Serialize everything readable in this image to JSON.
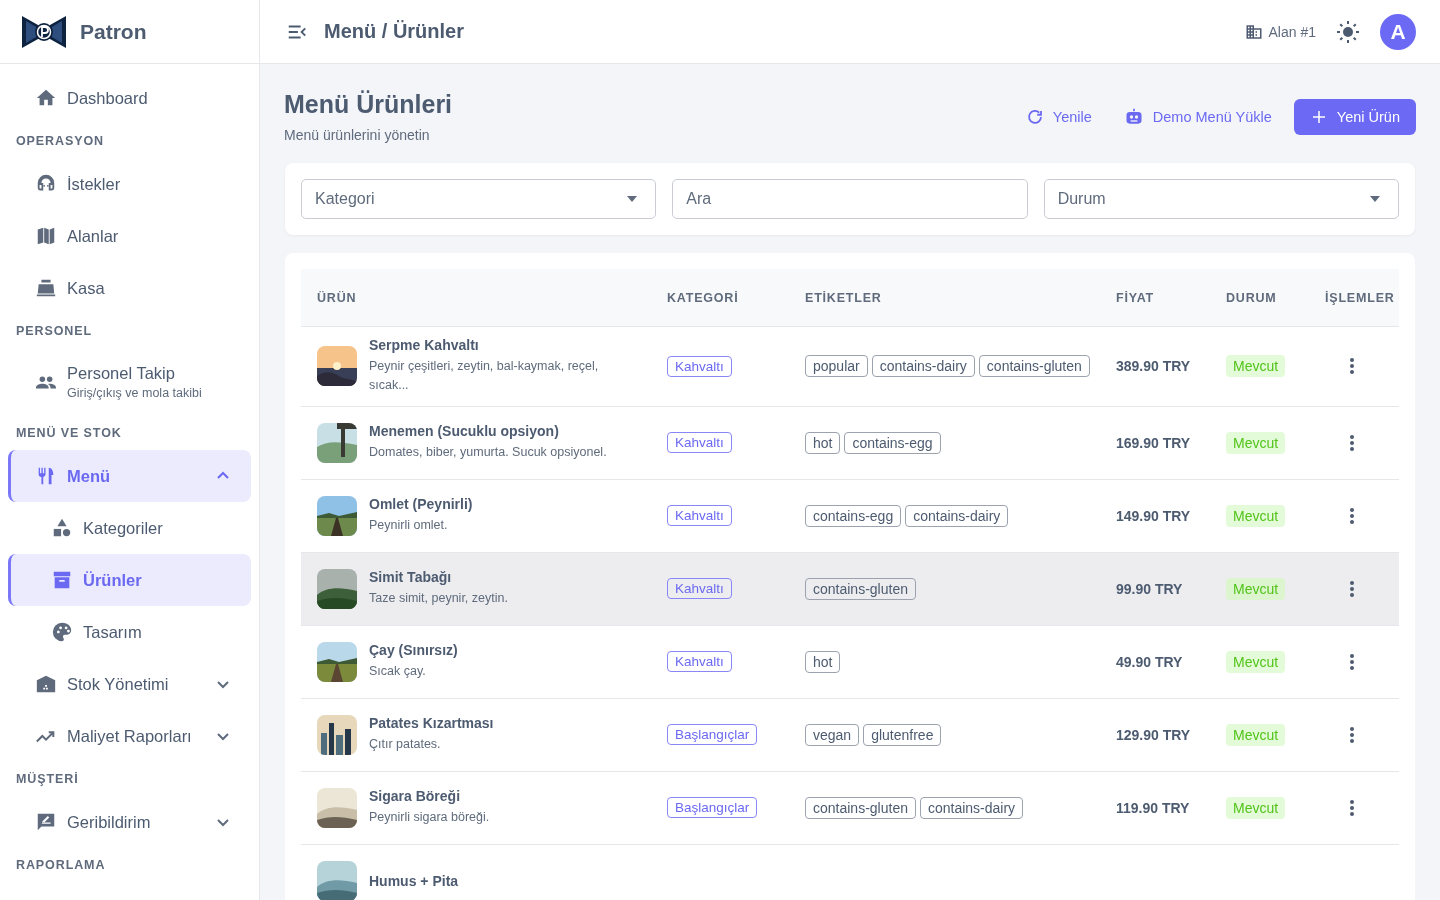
{
  "sidebar": {
    "brand": "Patron",
    "items": [
      {
        "kind": "link",
        "label": "Dashboard",
        "selected": false
      },
      {
        "kind": "section",
        "label": "OPERASYON"
      },
      {
        "kind": "link",
        "label": "İstekler",
        "selected": false
      },
      {
        "kind": "link",
        "label": "Alanlar",
        "selected": false
      },
      {
        "kind": "link",
        "label": "Kasa",
        "selected": false
      },
      {
        "kind": "section",
        "label": "PERSONEL"
      },
      {
        "kind": "link",
        "label": "Personel Takip",
        "subtitle": "Giriş/çıkış ve mola takibi",
        "selected": false
      },
      {
        "kind": "section",
        "label": "MENÜ VE STOK"
      },
      {
        "kind": "group",
        "label": "Menü",
        "selected": true,
        "expanded": true,
        "children": [
          {
            "label": "Kategoriler",
            "selected": false
          },
          {
            "label": "Ürünler",
            "selected": true
          },
          {
            "label": "Tasarım",
            "selected": false
          }
        ]
      },
      {
        "kind": "group",
        "label": "Stok Yönetimi",
        "selected": false,
        "expanded": false
      },
      {
        "kind": "group",
        "label": "Maliyet Raporları",
        "selected": false,
        "expanded": false
      },
      {
        "kind": "section",
        "label": "MÜŞTERİ"
      },
      {
        "kind": "group",
        "label": "Geribildirim",
        "selected": false,
        "expanded": false
      },
      {
        "kind": "section",
        "label": "RAPORLAMA"
      }
    ]
  },
  "topbar": {
    "breadcrumb": "Menü / Ürünler",
    "location": "Alan #1",
    "avatar": "A"
  },
  "header": {
    "title": "Menü Ürünleri",
    "subtitle": "Menü ürünlerini yönetin",
    "buttons": [
      {
        "kind": "refresh",
        "label": "Yenile"
      },
      {
        "kind": "robot",
        "label": "Demo Menü Yükle"
      },
      {
        "kind": "primary",
        "label": "Yeni Ürün"
      }
    ]
  },
  "filters": [
    {
      "kind": "select",
      "placeholder": "Kategori"
    },
    {
      "kind": "search",
      "placeholder": "Ara"
    },
    {
      "kind": "select",
      "placeholder": "Durum"
    }
  ],
  "table": {
    "columns": [
      "ÜRÜN",
      "KATEGORİ",
      "ETİKETLER",
      "FİYAT",
      "DURUM",
      "İŞLEMLER"
    ],
    "rows": [
      {
        "name": "Serpme Kahvaltı",
        "description": "Peynir çeşitleri, zeytin, bal-kaymak, reçel, sıcak...",
        "category": "Kahvaltı",
        "tags": [
          "popular",
          "contains-dairy",
          "contains-gluten"
        ],
        "price": "389.90 TRY",
        "status": "Mevcut",
        "hovered": false
      },
      {
        "name": "Menemen (Sucuklu opsiyon)",
        "description": "Domates, biber, yumurta. Sucuk opsiyonel.",
        "category": "Kahvaltı",
        "tags": [
          "hot",
          "contains-egg"
        ],
        "price": "169.90 TRY",
        "status": "Mevcut",
        "hovered": false
      },
      {
        "name": "Omlet (Peynirli)",
        "description": "Peynirli omlet.",
        "category": "Kahvaltı",
        "tags": [
          "contains-egg",
          "contains-dairy"
        ],
        "price": "149.90 TRY",
        "status": "Mevcut",
        "hovered": false
      },
      {
        "name": "Simit Tabağı",
        "description": "Taze simit, peynir, zeytin.",
        "category": "Kahvaltı",
        "tags": [
          "contains-gluten"
        ],
        "price": "99.90 TRY",
        "status": "Mevcut",
        "hovered": true
      },
      {
        "name": "Çay (Sınırsız)",
        "description": "Sıcak çay.",
        "category": "Kahvaltı",
        "tags": [
          "hot"
        ],
        "price": "49.90 TRY",
        "status": "Mevcut",
        "hovered": false
      },
      {
        "name": "Patates Kızartması",
        "description": "Çıtır patates.",
        "category": "Başlangıçlar",
        "tags": [
          "vegan",
          "glutenfree"
        ],
        "price": "129.90 TRY",
        "status": "Mevcut",
        "hovered": false
      },
      {
        "name": "Sigara Böreği",
        "description": "Peynirli sigara böreği.",
        "category": "Başlangıçlar",
        "tags": [
          "contains-gluten",
          "contains-dairy"
        ],
        "price": "119.90 TRY",
        "status": "Mevcut",
        "hovered": false
      },
      {
        "name": "Humus + Pita",
        "hovered": false
      }
    ]
  }
}
